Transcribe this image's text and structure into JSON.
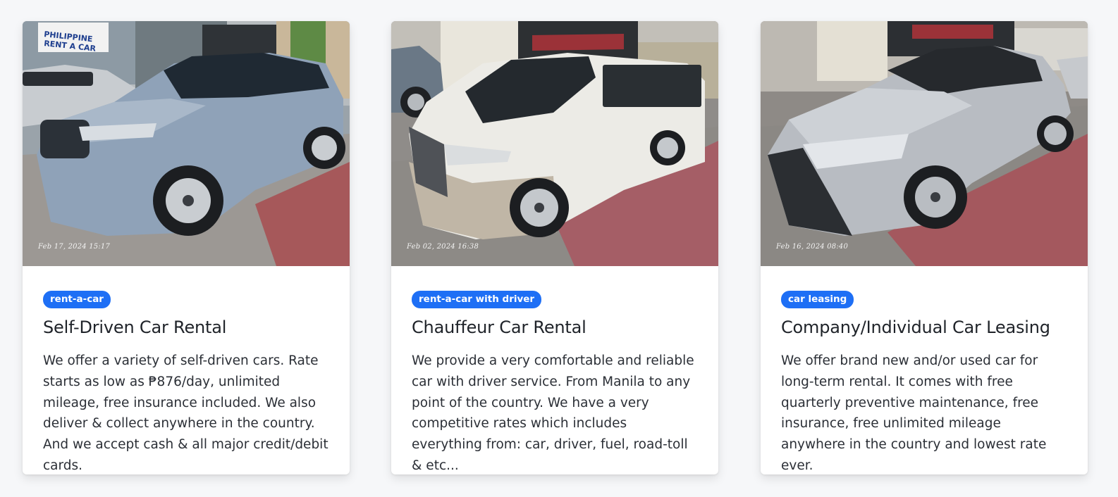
{
  "cards": [
    {
      "badge": "rent-a-car",
      "title": "Self-Driven Car Rental",
      "description": "We offer a variety of self-driven cars. Rate starts as low as ₱876/day, unlimited mileage, free insurance included. We also deliver & collect anywhere in the country. And we accept cash & all major credit/debit cards.",
      "photo_timestamp": "Feb 17, 2024 15:17",
      "photo_sign_text": [
        "PHILIPPINE",
        "RENT A CAR"
      ],
      "car_color": "#8fa2b8"
    },
    {
      "badge": "rent-a-car with driver",
      "title": "Chauffeur Car Rental",
      "description": "We provide a very comfortable and reliable car with driver service. From Manila to any point of the country. We have a very competitive rates which includes everything from: car, driver, fuel, road-toll & etc...",
      "photo_timestamp": "Feb 02, 2024 16:38",
      "car_color": "#ecebe6"
    },
    {
      "badge": "car leasing",
      "title": "Company/Individual Car Leasing",
      "description": "We offer brand new and/or used car for long-term rental. It comes with free quarterly preventive maintenance, free insurance, free unlimited mileage anywhere in the country and lowest rate ever.",
      "photo_timestamp": "Feb 16, 2024 08:40",
      "car_color": "#b8bcc2"
    }
  ],
  "colors": {
    "badge_bg": "#1e6ff5",
    "page_bg": "#f6f7f9"
  }
}
